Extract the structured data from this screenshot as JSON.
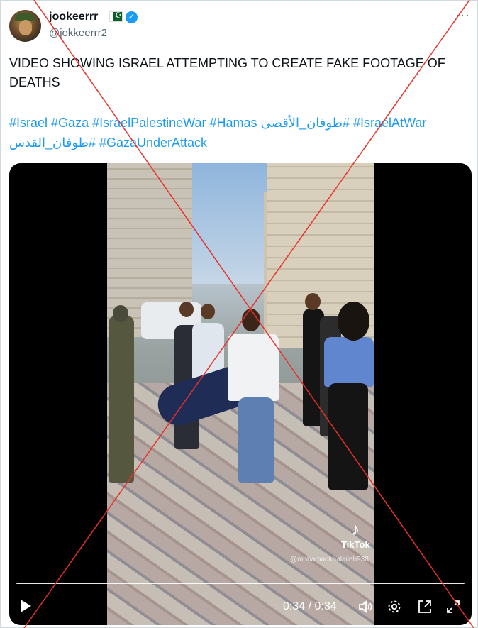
{
  "author": {
    "display_name": "jookeerrr",
    "handle": "@jokkeerrr2",
    "flag": "☪",
    "verified_icon": "✓",
    "more_icon": "···"
  },
  "tweet": {
    "text": "VIDEO SHOWING ISRAEL ATTEMPTING TO CREATE FAKE FOOTAGE OF DEATHS",
    "hashtags": [
      "#Israel",
      "#Gaza",
      "#IsraelPalestineWar",
      "#Hamas",
      "#طوفان_الأقصى",
      "#IsraelAtWar",
      "#طوفان_القدس",
      "#GazaUnderAttack"
    ]
  },
  "video": {
    "watermark_app": "TikTok",
    "watermark_user": "@mohamadkhalaileh938",
    "current_time": "0:34",
    "duration": "0:34",
    "time_display": "0:34 / 0:34",
    "progress": 1.0,
    "controls": [
      "play-icon",
      "volume-icon",
      "settings-icon",
      "pip-icon",
      "fullscreen-icon"
    ]
  },
  "overlay": {
    "cross_color": "#e8302a"
  }
}
